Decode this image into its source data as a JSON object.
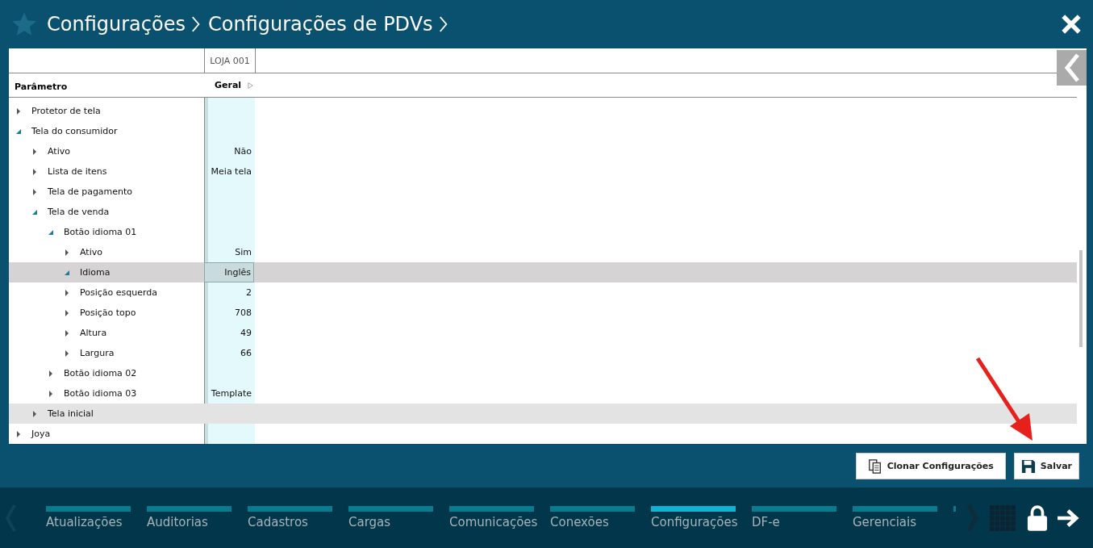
{
  "breadcrumb": [
    {
      "label": "Configurações"
    },
    {
      "label": "Configurações de PDVs"
    }
  ],
  "grid": {
    "store_column": "LOJA 001",
    "param_header": "Parâmetro",
    "value_header": "Geral",
    "rows": [
      {
        "label": "Protetor de tela",
        "expanded": false,
        "selected": false,
        "highlighted": false
      },
      {
        "label": "Tela do consumidor",
        "expanded": true,
        "selected": false,
        "highlighted": false,
        "children": [
          {
            "label": "Ativo",
            "value": "Não",
            "expanded": false,
            "selected": false,
            "highlighted": false
          },
          {
            "label": "Lista de itens",
            "value": "Meia tela",
            "expanded": false,
            "selected": false,
            "highlighted": false
          },
          {
            "label": "Tela de pagamento",
            "expanded": false,
            "selected": false,
            "highlighted": false
          },
          {
            "label": "Tela de venda",
            "expanded": true,
            "selected": false,
            "highlighted": false,
            "children": [
              {
                "label": "Botão idioma 01",
                "expanded": true,
                "selected": false,
                "highlighted": false,
                "children": [
                  {
                    "label": "Ativo",
                    "value": "Sim",
                    "expanded": false,
                    "selected": false,
                    "highlighted": false
                  },
                  {
                    "label": "Idioma",
                    "value": "Inglês",
                    "expanded": true,
                    "selected": true,
                    "highlighted": false
                  },
                  {
                    "label": "Posição esquerda",
                    "value": "2",
                    "expanded": false,
                    "selected": false,
                    "highlighted": false
                  },
                  {
                    "label": "Posição topo",
                    "value": "708",
                    "expanded": false,
                    "selected": false,
                    "highlighted": false
                  },
                  {
                    "label": "Altura",
                    "value": "49",
                    "expanded": false,
                    "selected": false,
                    "highlighted": false
                  },
                  {
                    "label": "Largura",
                    "value": "66",
                    "expanded": false,
                    "selected": false,
                    "highlighted": false
                  }
                ]
              },
              {
                "label": "Botão idioma 02",
                "expanded": false,
                "selected": false,
                "highlighted": false
              },
              {
                "label": "Botão idioma 03",
                "value": "Template",
                "expanded": false,
                "selected": false,
                "highlighted": false
              }
            ]
          },
          {
            "label": "Tela inicial",
            "expanded": false,
            "selected": false,
            "highlighted": true
          }
        ]
      },
      {
        "label": "Joya",
        "expanded": false,
        "selected": false,
        "highlighted": false
      }
    ]
  },
  "buttons": [
    {
      "label": "Clonar Configurações",
      "kind": "clone"
    },
    {
      "label": "Salvar",
      "kind": "save"
    }
  ],
  "nav": [
    {
      "label": "Atualizações",
      "selected": false
    },
    {
      "label": "Auditorias",
      "selected": false
    },
    {
      "label": "Cadastros",
      "selected": false
    },
    {
      "label": "Cargas",
      "selected": false
    },
    {
      "label": "Comunicações",
      "selected": false
    },
    {
      "label": "Conexões",
      "selected": false
    },
    {
      "label": "Configurações",
      "selected": true
    },
    {
      "label": "DF-e",
      "selected": false
    },
    {
      "label": "Gerenciais",
      "selected": false
    }
  ]
}
